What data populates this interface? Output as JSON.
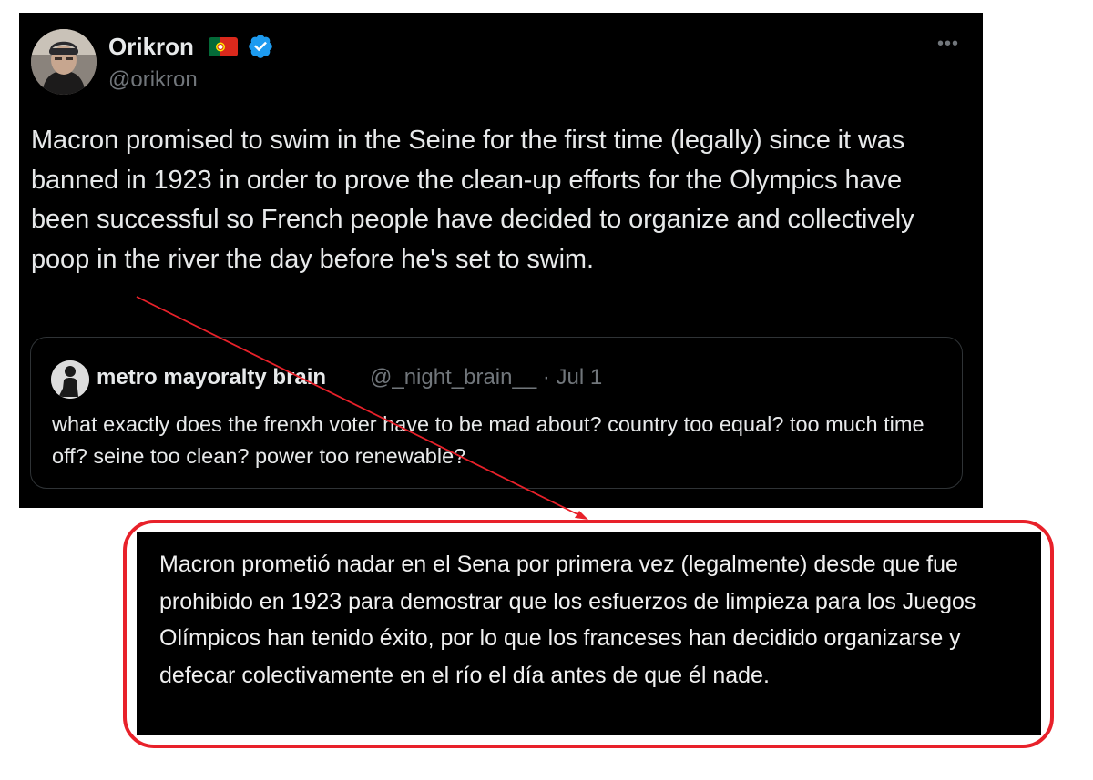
{
  "tweet": {
    "display_name": "Orikron",
    "handle": "@orikron",
    "text": "Macron promised to swim in the Seine for the first time (legally) since it was banned in 1923 in order to prove the clean-up efforts for the Olympics have been successful so French people have decided to organize and collectively poop in the river the day before he's set to swim.",
    "more_symbol": "•••",
    "flag": "portugal-flag-icon",
    "verified": "verified-badge-icon",
    "colors": {
      "background": "#000000",
      "text": "#e7e9ea",
      "secondary": "#71767b",
      "verified": "#1d9bf0"
    }
  },
  "quoted_tweet": {
    "display_name": "metro mayoralty brain",
    "handle": "@_night_brain__",
    "separator": "·",
    "date": "Jul 1",
    "text": "what exactly does the frenxh voter have to be mad about? country too equal? too much time off? seine too clean? power too renewable?"
  },
  "translation": {
    "text": "Macron prometió nadar en el Sena por primera vez (legalmente) desde que fue prohibido en 1923 para demostrar que los esfuerzos de limpieza para los Juegos Olímpicos han tenido éxito, por lo que los franceses han decidido organizarse y defecar colectivamente en el río el día antes de que él nade.",
    "frame_color": "#e8212a",
    "arrow_color": "#e8212a"
  }
}
